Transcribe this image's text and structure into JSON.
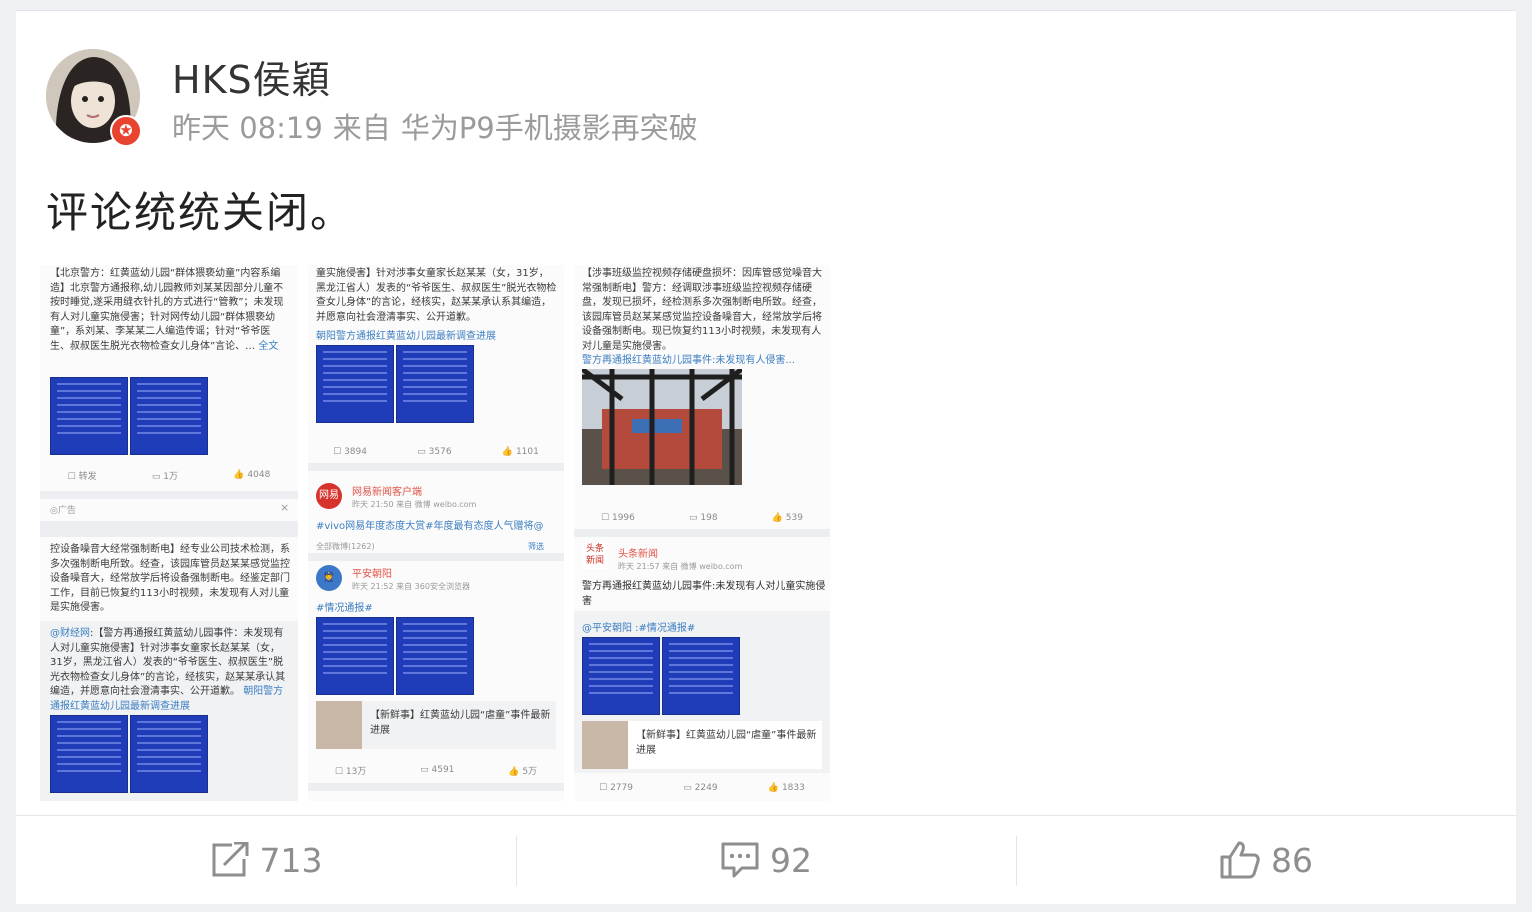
{
  "post": {
    "username": "HKS侯穎",
    "time": "昨天 08:19",
    "source_prefix": "来自",
    "source": "华为P9手机摄影再突破",
    "text": "评论统统关闭。"
  },
  "shot1": {
    "text": "【北京警方：红黄蓝幼儿园“群体猥亵幼童”内容系编造】北京警方通报称,幼儿园教师刘某某因部分儿童不按时睡觉,遂采用缝衣针扎的方式进行“管教”；未发现有人对儿童实施侵害；针对网传幼儿园“群体猥亵幼童”，系刘某、李某某二人编造传谣；针对“爷爷医生、叔叔医生脱光衣物检查女儿身体”言论、…",
    "more": "全文",
    "repost": "转发",
    "comment": "1万",
    "like": "4048",
    "ad": "广告",
    "text2": "控设备噪音大经常强制断电】经专业公司技术检测，系多次强制断电所致。经查，该园库管员赵某某感觉监控设备噪音大，经常放学后将设备强制断电。经鉴定部门工作，目前已恢复约113小时视频，未发现有人对儿童是实施侵害。",
    "quote_user": "@财经网",
    "quote_text": ":【警方再通报红黄蓝幼儿园事件：未发现有人对儿童实施侵害】针对涉事女童家长赵某某（女，31岁，黑龙江省人）发表的“爷爷医生、叔叔医生”脱光衣物检查女儿身体”的言论，经核实，赵某某承认其编造，并愿意向社会澄清事实、公开道歉。",
    "quote_link": "朝阳警方通报红黄蓝幼儿园最新调查进展"
  },
  "shot2": {
    "text": "童实施侵害】针对涉事女童家长赵某某（女，31岁，黑龙江省人）发表的“爷爷医生、叔叔医生”脱光衣物检查女儿身体”的言论，经核实，赵某某承认系其编造，并愿意向社会澄清事实、公开道歉。",
    "link": "朝阳警方通报红黄蓝幼儿园最新调查进展",
    "repost": "3894",
    "comment": "3576",
    "like": "1101",
    "acct1_name": "网易新闻客户端",
    "acct1_logo": "网易",
    "acct1_sub": "昨天 21:50  来自 微博 weibo.com",
    "acct1_text": "#vivo网易年度态度大赏#年度最有态度人气赠将@",
    "all_weibo": "全部微博(1262)",
    "filter": "筛选",
    "acct2_name": "平安朝阳",
    "acct2_sub": "昨天 21:52  来自 360安全浏览器",
    "acct2_tag": "#情况通报#",
    "card_text": "【新鲜事】红黄蓝幼儿园“虐童”事件最新进展",
    "repost2": "13万",
    "comment2": "4591",
    "like2": "5万"
  },
  "shot3": {
    "text": "【涉事班级监控视频存储硬盘损坏：因库管感觉噪音大常强制断电】警方：经调取涉事班级监控视频存储硬盘，发现已损坏，经检测系多次强制断电所致。经查，该园库管员赵某某感觉监控设备噪音大，经常放学后将设备强制断电。现已恢复约113小时视频，未发现有人对儿童是实施侵害。",
    "link": "警方再通报红黄蓝幼儿园事件:未发现有人侵害...",
    "repost": "1996",
    "comment": "198",
    "like": "539",
    "acct_name": "头条新闻",
    "acct_logo": "头条新闻",
    "acct_sub": "昨天 21:57  来自 微博 weibo.com",
    "acct_text": "警方再通报红黄蓝幼儿园事件:未发现有人对儿童实施侵害",
    "quote": "@平安朝阳 :#情况通报#",
    "card_text": "【新鲜事】红黄蓝幼儿园“虐童”事件最新进展",
    "repost2": "2779",
    "comment2": "2249",
    "like2": "1833"
  },
  "actions": {
    "repost_count": "713",
    "comment_count": "92",
    "like_count": "86"
  },
  "colors": {
    "link": "#3c7ec1",
    "weibo_orange": "#e0554a",
    "thumb_blue": "#1f3db8"
  }
}
